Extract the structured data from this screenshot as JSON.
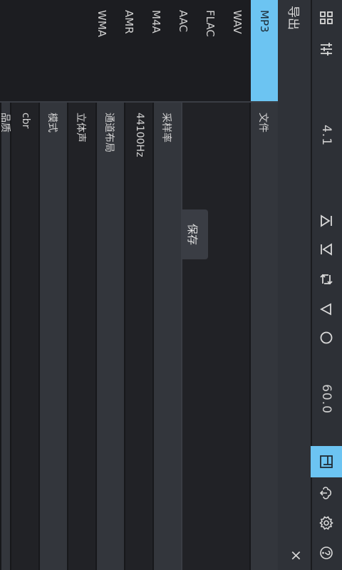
{
  "toolbar": {
    "icons": [
      "grid-icon",
      "sliders-icon",
      "skip-start-icon",
      "skip-end-icon",
      "repeat-icon",
      "play-icon",
      "record-icon",
      "export-icon",
      "cloud-download-icon",
      "gear-icon",
      "help-icon"
    ],
    "value_a": "4.1",
    "value_b": "60.0",
    "accent": "#6cc4f2"
  },
  "export": {
    "title": "导出",
    "close": "×"
  },
  "formats": [
    "MP3",
    "WAV",
    "FLAC",
    "AAC",
    "M4A",
    "AMR",
    "WMA"
  ],
  "selected_format": "MP3",
  "table": {
    "rows": [
      {
        "label": "文件",
        "value": ""
      },
      {
        "label": "",
        "value": ""
      },
      {
        "label": "采样率",
        "value": ""
      },
      {
        "label": "44100Hz",
        "value": ""
      },
      {
        "label": "通道布局",
        "value": ""
      },
      {
        "label": "立体声",
        "value": ""
      },
      {
        "label": "模式",
        "value": ""
      },
      {
        "label": "cbr",
        "value": ""
      },
      {
        "label": "品质",
        "value": ""
      }
    ],
    "save_label": "保存"
  }
}
